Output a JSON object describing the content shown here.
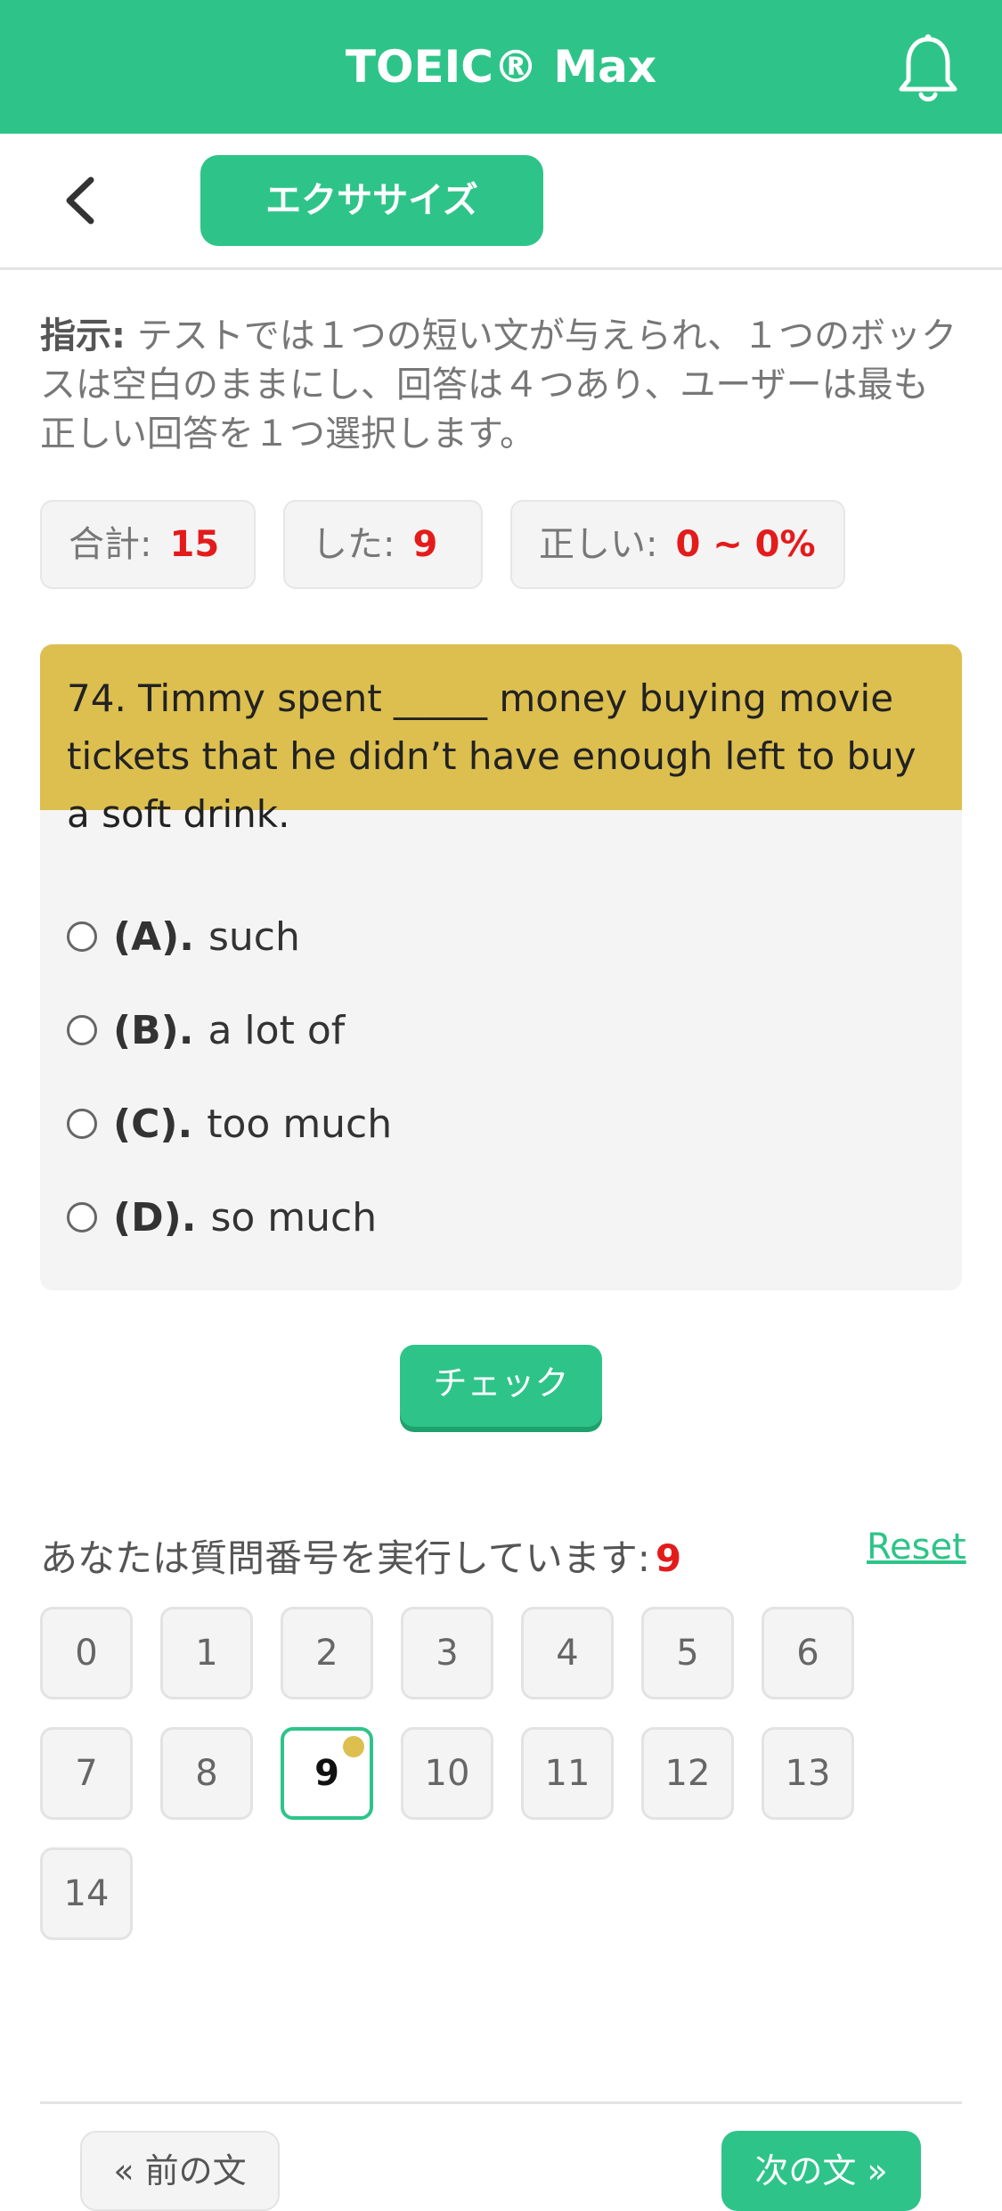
{
  "header": {
    "title": "TOEIC® Max",
    "notification_icon": "bell-icon",
    "color": "#2ec489"
  },
  "subheader": {
    "back_icon": "chevron-left-icon",
    "exercise_label": "エクササイズ"
  },
  "instruction": {
    "label": "指示:",
    "text": " テストでは１つの短い文が与えられ、１つのボックスは空白のままにし、回答は４つあり、ユーザーは最も正しい回答を１つ選択します。"
  },
  "stats": {
    "total_label": "合計:",
    "total_value": "15",
    "done_label": "した:",
    "done_value": "9",
    "correct_label": "正しい:",
    "correct_value": "0 ~ 0%"
  },
  "question": {
    "text": "74. Timmy spent _____ money buying movie tickets that he didn’t have enough left to buy a soft drink.",
    "options": [
      {
        "letter": "(A).",
        "text": "such"
      },
      {
        "letter": "(B).",
        "text": "a lot of"
      },
      {
        "letter": "(C).",
        "text": "too much"
      },
      {
        "letter": "(D).",
        "text": "so much"
      }
    ],
    "check_label": "チェック"
  },
  "progress": {
    "label": "あなたは質問番号を実行しています:",
    "current": "9",
    "reset_label": "Reset",
    "numbers": [
      "0",
      "1",
      "2",
      "3",
      "4",
      "5",
      "6",
      "7",
      "8",
      "9",
      "10",
      "11",
      "12",
      "13",
      "14"
    ]
  },
  "footer": {
    "prev_label": "« 前の文",
    "next_label": "次の文 »"
  }
}
